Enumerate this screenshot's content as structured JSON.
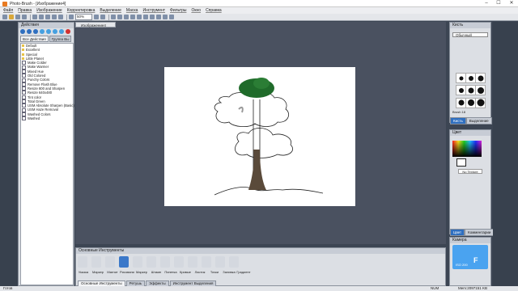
{
  "window": {
    "title": "Photo-Brush - [Изображение4]",
    "min": "–",
    "max": "☐",
    "close": "✕"
  },
  "menu": [
    "Файл",
    "Правка",
    "Изображение",
    "Корректировка",
    "Выделение",
    "Маска",
    "Инструмент",
    "Фильтры",
    "Окно",
    "Справка"
  ],
  "toolbar": {
    "zoom": "50%"
  },
  "actions": {
    "title": "Действия",
    "tabs": [
      "Все Действия",
      "Группа Вы"
    ],
    "items": [
      {
        "label": "Default",
        "checked": false
      },
      {
        "label": "Excellent",
        "checked": false
      },
      {
        "label": "Special",
        "checked": false
      },
      {
        "label": "Little Planet",
        "checked": false
      },
      {
        "label": "Make Colder",
        "checked": true
      },
      {
        "label": "Make Warmer",
        "checked": true
      },
      {
        "label": "Mixed Hue",
        "checked": true
      },
      {
        "label": "Old Colored",
        "checked": true
      },
      {
        "label": "Punchy Colors",
        "checked": true
      },
      {
        "label": "Remove Flash Blue",
        "checked": true
      },
      {
        "label": "Resize 800 and Sharpen",
        "checked": true
      },
      {
        "label": "Resize 640x480",
        "checked": true
      },
      {
        "label": "Tint color",
        "checked": true
      },
      {
        "label": "Total Green",
        "checked": true
      },
      {
        "label": "USM Absolute Sharpen (Basic)",
        "checked": true
      },
      {
        "label": "USM Haze Removal",
        "checked": true
      },
      {
        "label": "Washed Colors",
        "checked": true
      },
      {
        "label": "Washed",
        "checked": true
      }
    ]
  },
  "document": {
    "tab": "Изображение4"
  },
  "tools": {
    "title": "Основные Инструменты",
    "labels": [
      "Указка",
      "Маркер",
      "Магнит",
      "Рисование",
      "Маркер",
      "Штамп",
      "Пипетка",
      "Кривые",
      "Ластик",
      "Точки",
      "Заливка",
      "Градиент"
    ],
    "bottom_tabs": [
      "Основные Инструменты",
      "Ретушь",
      "Эффекты",
      "Инструмент Выделения"
    ]
  },
  "brush": {
    "title": "Кисть",
    "preset": "Обычный",
    "name_label": "Brush 18",
    "tabs": [
      "Кисть",
      "Выделение"
    ]
  },
  "color": {
    "title": "Цвет",
    "no_color": "No Texture",
    "tabs": [
      "Цвет",
      "Комментарии"
    ]
  },
  "camera": {
    "title": "Камера",
    "big": "F",
    "small": "ISO 200"
  },
  "status": {
    "left": "Готов",
    "mode": "NUM",
    "memory": "Mem:2097151 KB"
  },
  "colors": {
    "accent": "#2f6fc0",
    "camera": "#4aa3f0",
    "tree_green": "#1f6b2a"
  }
}
